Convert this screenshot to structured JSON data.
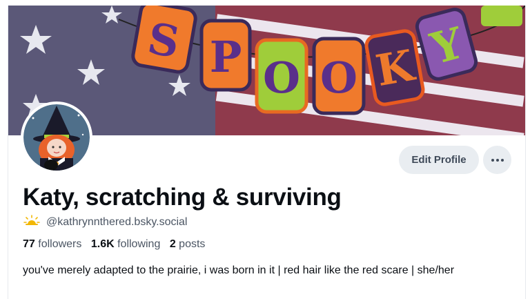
{
  "profile": {
    "display_name": "Katy, scratching & surviving",
    "handle": "@kathrynnthered.bsky.social",
    "handle_icon": "sun-cloud-icon",
    "followers_count": "77",
    "followers_label": "followers",
    "following_count": "1.6K",
    "following_label": "following",
    "posts_count": "2",
    "posts_label": "posts",
    "bio": "you've merely adapted to the prairie, i was born in it | red hair like the red scare | she/her"
  },
  "actions": {
    "edit_profile_label": "Edit Profile",
    "more_icon": "ellipsis-icon"
  },
  "banner": {
    "letters": [
      "S",
      "P",
      "O",
      "O",
      "K",
      "Y"
    ]
  },
  "colors": {
    "button_bg": "#e9edf1",
    "button_text": "#3f4a59",
    "muted_text": "#4b5563",
    "primary_text": "#0b0f14"
  }
}
